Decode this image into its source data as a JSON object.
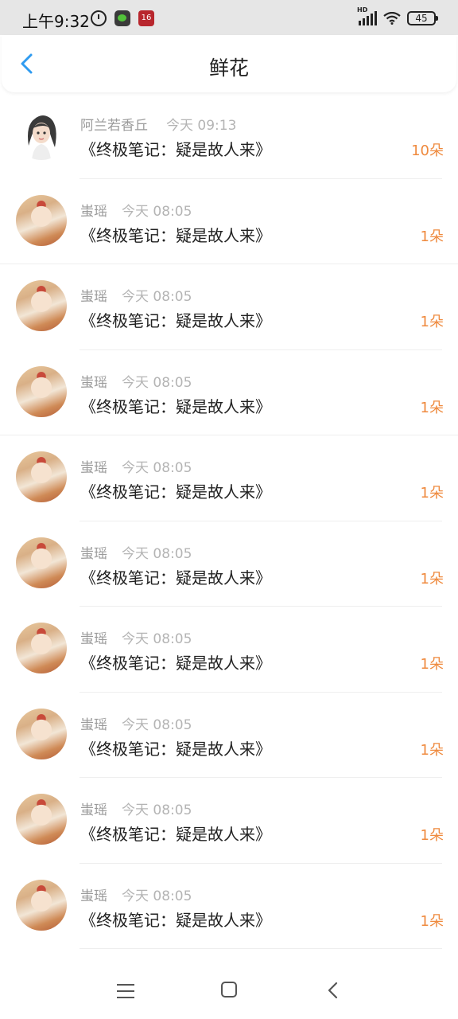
{
  "status_bar": {
    "time": "上午9:32",
    "app_badge": "16",
    "battery": "45",
    "network": "HD"
  },
  "header": {
    "title": "鲜花"
  },
  "items": [
    {
      "name": "阿兰若香丘",
      "time": "今天 09:13",
      "book": "《终极笔记：疑是故人来》",
      "count": "10朵",
      "avatar": "cartoon"
    },
    {
      "name": "蚩瑶",
      "time": "今天 08:05",
      "book": "《终极笔记：疑是故人来》",
      "count": "1朵",
      "avatar": "photo"
    },
    {
      "name": "蚩瑶",
      "time": "今天 08:05",
      "book": "《终极笔记：疑是故人来》",
      "count": "1朵",
      "avatar": "photo"
    },
    {
      "name": "蚩瑶",
      "time": "今天 08:05",
      "book": "《终极笔记：疑是故人来》",
      "count": "1朵",
      "avatar": "photo"
    },
    {
      "name": "蚩瑶",
      "time": "今天 08:05",
      "book": "《终极笔记：疑是故人来》",
      "count": "1朵",
      "avatar": "photo"
    },
    {
      "name": "蚩瑶",
      "time": "今天 08:05",
      "book": "《终极笔记：疑是故人来》",
      "count": "1朵",
      "avatar": "photo"
    },
    {
      "name": "蚩瑶",
      "time": "今天 08:05",
      "book": "《终极笔记：疑是故人来》",
      "count": "1朵",
      "avatar": "photo"
    },
    {
      "name": "蚩瑶",
      "time": "今天 08:05",
      "book": "《终极笔记：疑是故人来》",
      "count": "1朵",
      "avatar": "photo"
    },
    {
      "name": "蚩瑶",
      "time": "今天 08:05",
      "book": "《终极笔记：疑是故人来》",
      "count": "1朵",
      "avatar": "photo"
    },
    {
      "name": "蚩瑶",
      "time": "今天 08:05",
      "book": "《终极笔记：疑是故人来》",
      "count": "1朵",
      "avatar": "photo"
    }
  ],
  "colors": {
    "accent": "#2f9bf0",
    "count": "#ef8a3e",
    "meta": "#9a9a9a"
  }
}
